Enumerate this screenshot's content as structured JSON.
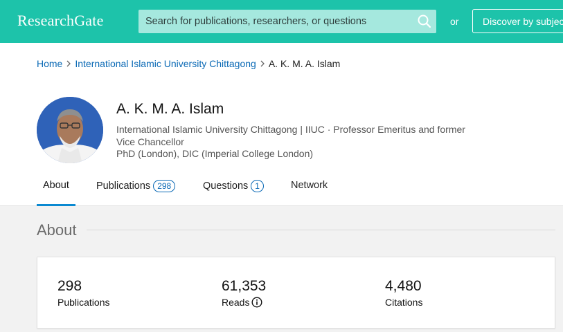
{
  "header": {
    "logo": "ResearchGate",
    "search_placeholder": "Search for publications, researchers, or questions",
    "or_label": "or",
    "discover_label": "Discover by subject area",
    "brand_color": "#1dc3aa"
  },
  "breadcrumb": {
    "home": "Home",
    "institution": "International Islamic University Chittagong",
    "current": "A. K. M. A. Islam"
  },
  "profile": {
    "name": "A. K. M. A. Islam",
    "affiliation": "International Islamic University Chittagong | IIUC · Professor Emeritus and former Vice Chancellor",
    "degree": "PhD (London), DIC (Imperial College London)"
  },
  "tabs": [
    {
      "label": "About",
      "badge": ""
    },
    {
      "label": "Publications",
      "badge": "298"
    },
    {
      "label": "Questions",
      "badge": "1"
    },
    {
      "label": "Network",
      "badge": ""
    }
  ],
  "about": {
    "title": "About",
    "stats": [
      {
        "value": "298",
        "label": "Publications"
      },
      {
        "value": "61,353",
        "label": "Reads"
      },
      {
        "value": "4,480",
        "label": "Citations"
      }
    ]
  }
}
